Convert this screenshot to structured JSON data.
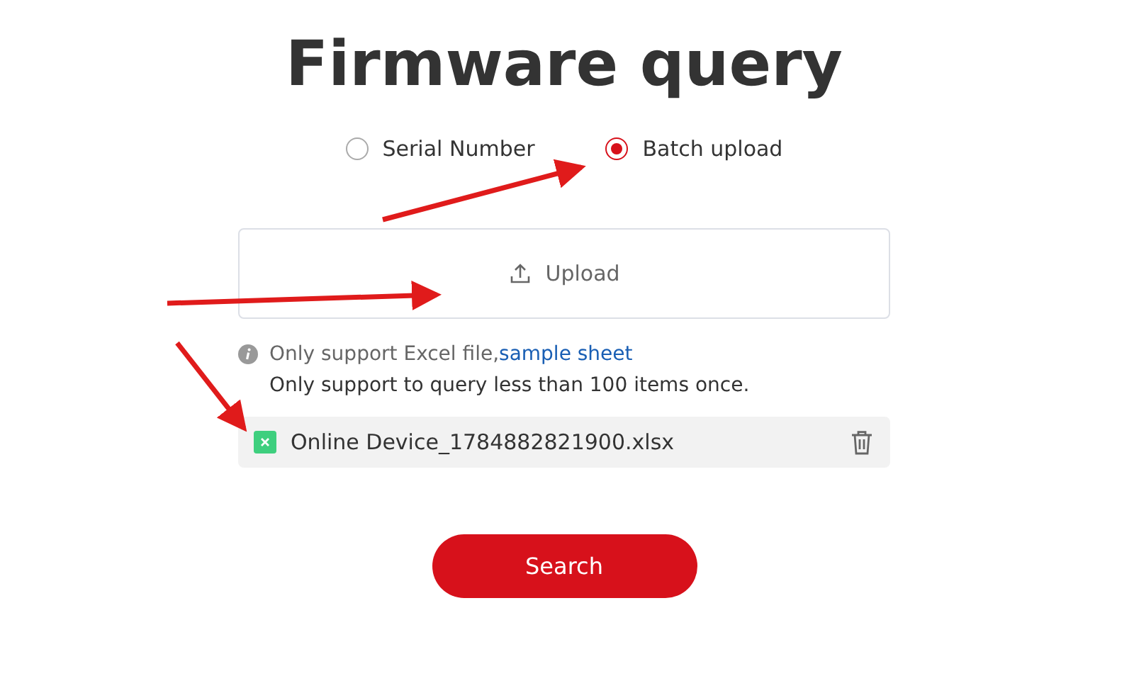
{
  "title": "Firmware query",
  "query_modes": [
    {
      "label": "Serial Number",
      "selected": false
    },
    {
      "label": "Batch upload",
      "selected": true
    }
  ],
  "upload": {
    "label": "Upload"
  },
  "notes": {
    "info": "Only support Excel file,",
    "link": "sample sheet",
    "limit": "Only support to query less than 100 items once."
  },
  "files": [
    {
      "name": "Online Device_1784882821900.xlsx"
    }
  ],
  "search_button": "Search"
}
